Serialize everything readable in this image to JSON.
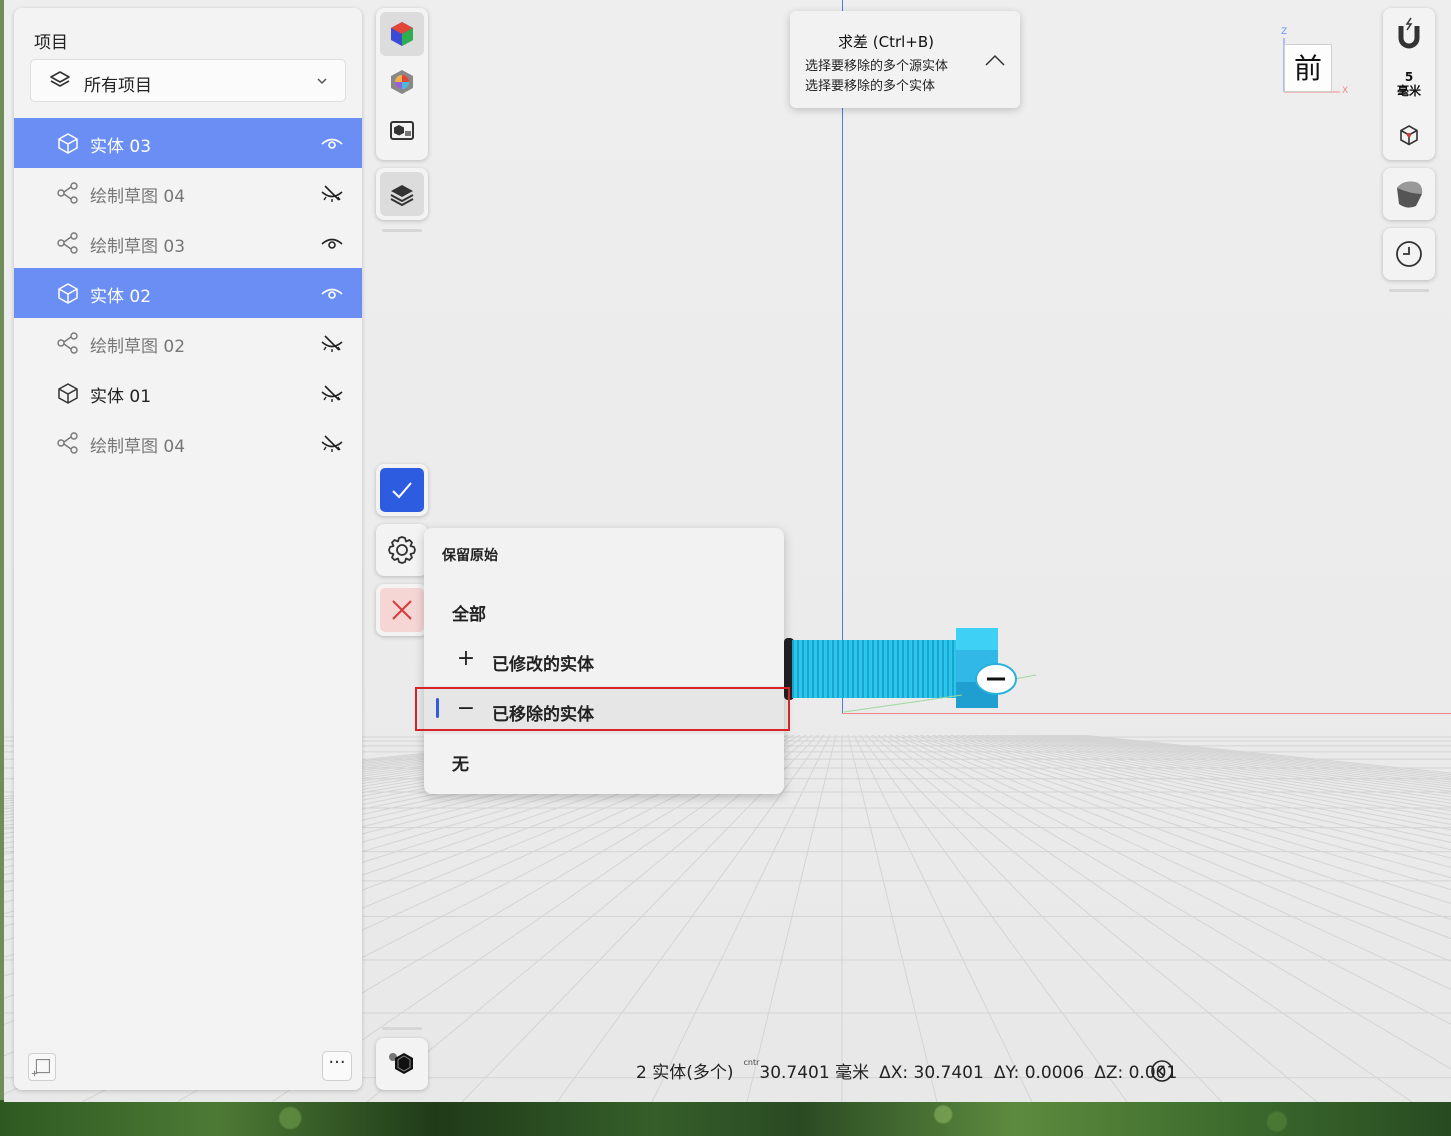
{
  "panel": {
    "title": "项目",
    "filter": {
      "label": "所有项目",
      "icon": "layers-icon"
    },
    "items": [
      {
        "name": "实体  03",
        "type": "solid",
        "selected": true,
        "visible": true
      },
      {
        "name": "绘制草图 04",
        "type": "sketch",
        "selected": false,
        "visible": false
      },
      {
        "name": "绘制草图 03",
        "type": "sketch",
        "selected": false,
        "visible": true
      },
      {
        "name": "实体  02",
        "type": "solid",
        "selected": true,
        "visible": true
      },
      {
        "name": "绘制草图 02",
        "type": "sketch",
        "selected": false,
        "visible": false
      },
      {
        "name": "实体  01",
        "type": "solid",
        "selected": false,
        "visible": false
      },
      {
        "name": "绘制草图 04",
        "type": "sketch",
        "selected": false,
        "visible": false
      }
    ],
    "more_label": "···"
  },
  "operation": {
    "title": "求差 (Ctrl+B)",
    "line1": "选择要移除的多个源实体",
    "line2": "选择要移除的多个实体"
  },
  "keep_menu": {
    "heading": "保留原始",
    "items": [
      {
        "symbol": "",
        "label": "全部"
      },
      {
        "symbol": "+",
        "label": "已修改的实体"
      },
      {
        "symbol": "−",
        "label": "已移除的实体",
        "current": true
      },
      {
        "symbol": "",
        "label": "无"
      }
    ]
  },
  "view_cube": {
    "face": "前",
    "z_label": "Z",
    "x_label": "X"
  },
  "snap": {
    "value": "5",
    "unit": "毫米"
  },
  "status": {
    "selection": "2 实体(多个)",
    "tag": "cntr",
    "distance": "30.7401 毫米",
    "dx": "ΔX: 30.7401",
    "dy": "ΔY: 0.0006",
    "dz": "ΔZ: 0.001"
  },
  "colors": {
    "accent": "#2e5ce0",
    "selection": "#6b8ef5",
    "bolt": "#29c4ea",
    "highlight": "#d6232a"
  }
}
